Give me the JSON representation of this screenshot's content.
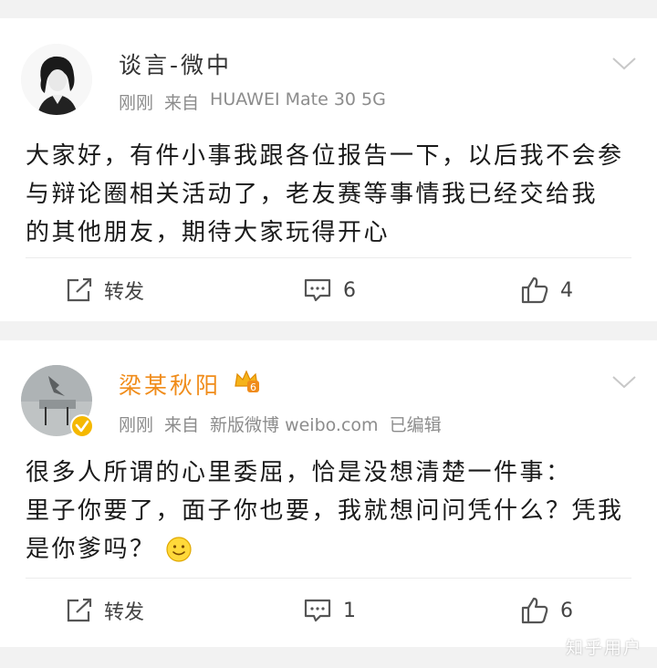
{
  "posts": [
    {
      "username": "谈言-微中",
      "time": "刚刚",
      "source_prefix": "来自",
      "source": "HUAWEI Mate 30 5G",
      "edited": "",
      "lines": [
        "大家好，有件小事我跟各位报告一下，以后我不会参",
        "与辩论圈相关活动了，老友赛等事情我已经交给我",
        "的其他朋友，期待大家玩得开心"
      ],
      "repost_label": "转发",
      "comment_count": "6",
      "like_count": "4"
    },
    {
      "username": "梁某秋阳",
      "time": "刚刚",
      "source_prefix": "来自",
      "source": "新版微博 weibo.com",
      "edited": "已编辑",
      "vip_level": "6",
      "lines": [
        "很多人所谓的心里委屈，恰是没想清楚一件事：",
        "里子你要了，面子你也要，我就想问问凭什么？凭我",
        "是你爹吗？"
      ],
      "repost_label": "转发",
      "comment_count": "1",
      "like_count": "6"
    }
  ],
  "watermark": "知乎用户",
  "colors": {
    "vip_username": "#f08c1a",
    "meta_gray": "#8c8c8c",
    "verified_badge": "#f5b800"
  }
}
